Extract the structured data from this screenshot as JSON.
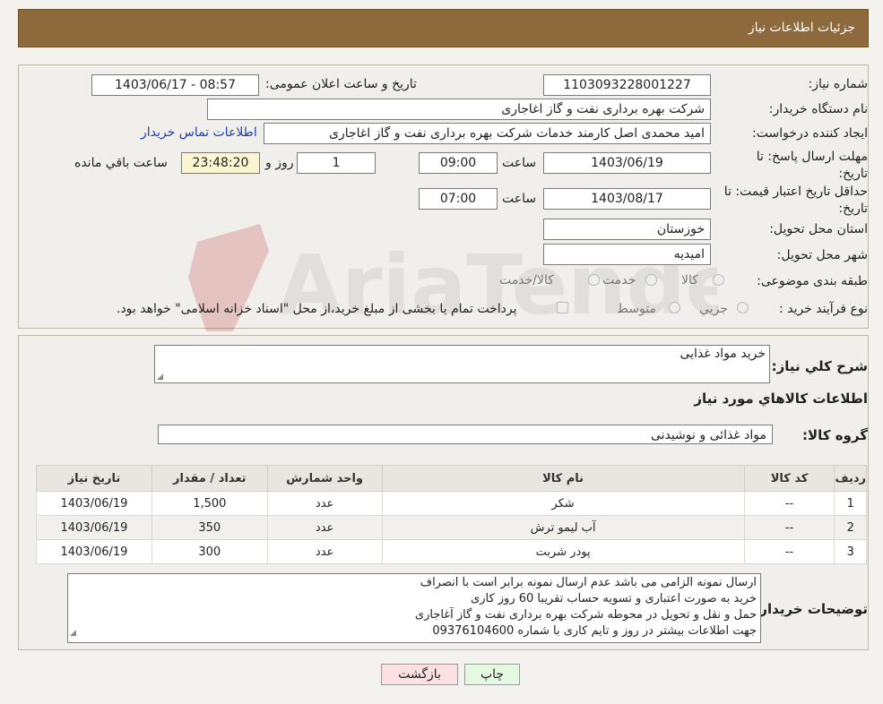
{
  "header": {
    "title": "جزئیات اطلاعات نیاز"
  },
  "form": {
    "need_number_label": "شماره نیاز:",
    "need_number": "1103093228001227",
    "announce_label": "تاریخ و ساعت اعلان عمومی:",
    "announce_value": "1403/06/17 - 08:57",
    "buyer_org_label": "نام دستگاه خریدار:",
    "buyer_org": "شرکت بهره برداری نفت و گاز اغاجاری",
    "creator_label": "ایجاد کننده درخواست:",
    "creator": "امید محمدی اصل کارمند خدمات شرکت بهره برداری نفت و گاز اغاجاری",
    "contact_link": "اطلاعات تماس خریدار",
    "deadline_label": "مهلت ارسال پاسخ: تا تاریخ:",
    "deadline_date": "1403/06/19",
    "time_label": "ساعت",
    "deadline_time": "09:00",
    "days_value": "1",
    "days_label": "روز و",
    "remaining_time": "23:48:20",
    "remaining_label": "ساعت باقي مانده",
    "validity_label": "حداقل تاریخ اعتبار قیمت: تا تاریخ:",
    "validity_date": "1403/08/17",
    "validity_time": "07:00",
    "province_label": "استان محل تحویل:",
    "province": "خوزستان",
    "city_label": "شهر محل تحویل:",
    "city": "امیدیه",
    "category_label": "طبقه بندی موضوعی:",
    "category_options": [
      "کالا",
      "خدمت",
      "کالا/خدمت"
    ],
    "process_label": "نوع فرآیند خرید :",
    "process_options": [
      "جزیي",
      "متوسط"
    ],
    "process_note": "پرداخت تمام یا بخشی از مبلغ خرید،از محل \"اسناد خزانه اسلامی\" خواهد بود."
  },
  "detail": {
    "summary_label": "شرح كلي نياز:",
    "summary": "خرید مواد غذایی",
    "items_heading": "اطلاعات كالاهاي مورد نياز",
    "group_label": "گروه کالا:",
    "group": "مواد غذائی و نوشیدنی"
  },
  "table": {
    "headers": [
      "رديف",
      "کد کالا",
      "نام كالا",
      "واحد شمارش",
      "تعداد / مقدار",
      "تاریخ نیاز"
    ],
    "rows": [
      [
        "1",
        "--",
        "شکر",
        "عدد",
        "1,500",
        "1403/06/19"
      ],
      [
        "2",
        "--",
        "آب لیمو ترش",
        "عدد",
        "350",
        "1403/06/19"
      ],
      [
        "3",
        "--",
        "پودر شربت",
        "عدد",
        "300",
        "1403/06/19"
      ]
    ]
  },
  "buyer_notes": {
    "label": "توضیحات خریدار:",
    "lines": [
      "ارسال نمونه الزامی می باشد عدم ارسال نمونه برابر است با انصراف",
      "خرید به صورت اعتباری و تسویه حساب تقریبا  60 روز کاری",
      "حمل و نقل و تحویل در محوطه  شرکت بهره برداری نفت و گاز آغاجاری",
      "جهت اطلاعات بیشتر در روز و تایم کاری با شماره 09376104600"
    ]
  },
  "buttons": {
    "print": "چاپ",
    "back": "بازگشت"
  },
  "watermark": {
    "text": "AriaTender.neT"
  },
  "colors": {
    "header_bg": "#8c6a3c",
    "link": "#1a3fb0",
    "remaining_bg": "#fbf5d2",
    "back_bg": "#fbe1e1",
    "print_bg": "#e5f8e1"
  }
}
